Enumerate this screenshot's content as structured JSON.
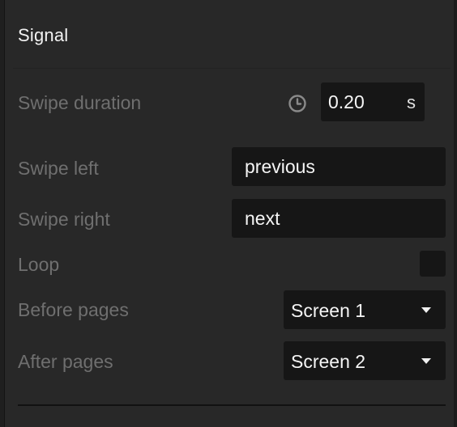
{
  "section": {
    "title": "Signal"
  },
  "swipe_duration": {
    "label": "Swipe duration",
    "icon": "clock-icon",
    "value": "0.20",
    "unit": "s"
  },
  "swipe_left": {
    "label": "Swipe left",
    "value": "previous"
  },
  "swipe_right": {
    "label": "Swipe right",
    "value": "next"
  },
  "loop": {
    "label": "Loop",
    "checked": false
  },
  "before_pages": {
    "label": "Before pages",
    "selected": "Screen 1"
  },
  "after_pages": {
    "label": "After pages",
    "selected": "Screen 2"
  },
  "colors": {
    "panel_bg": "#282828",
    "field_bg": "#161616",
    "label_text": "#6f6f6f",
    "value_text": "#f5f5f5"
  }
}
